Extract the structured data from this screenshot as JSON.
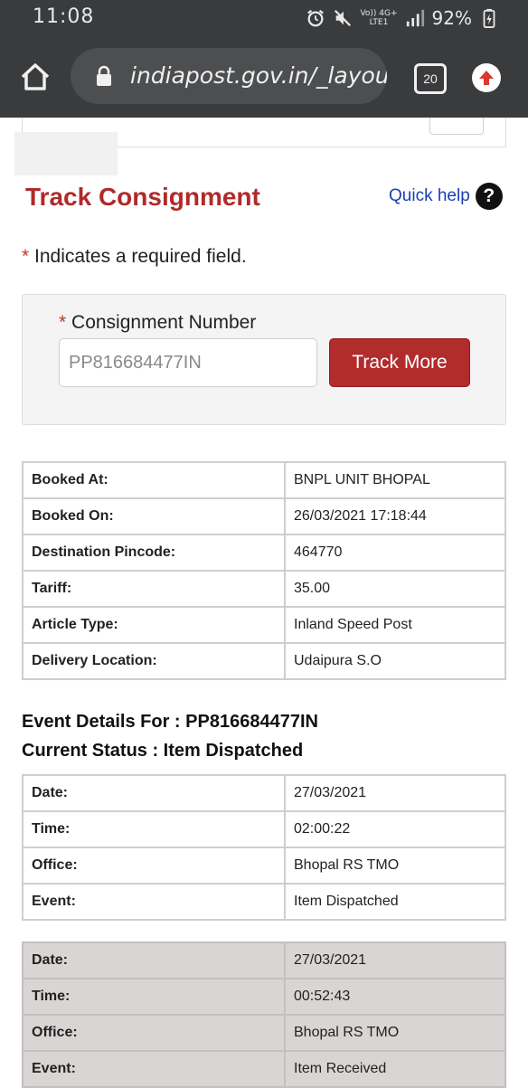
{
  "statusbar": {
    "time": "11:08",
    "network_top": "Vo)) 4G+",
    "network_bottom": "LTE1",
    "battery": "92%",
    "icons": [
      "alarm-icon",
      "mute-icon",
      "signal-icon",
      "battery-icon"
    ]
  },
  "browser": {
    "url": "indiapost.gov.in/_layouts",
    "tab_count": "20",
    "icons": [
      "home-icon",
      "lock-icon",
      "tabs-icon",
      "update-icon"
    ]
  },
  "page": {
    "title": "Track Consignment",
    "quick_help": "Quick help",
    "quick_help_icon": "?",
    "required_star": "*",
    "required_note": " Indicates a required field.",
    "form": {
      "label": "Consignment Number",
      "input_value": "PP816684477IN",
      "button_label": "Track More"
    },
    "booking": [
      {
        "key": "Booked At:",
        "value": "BNPL UNIT BHOPAL"
      },
      {
        "key": "Booked On:",
        "value": "26/03/2021 17:18:44"
      },
      {
        "key": "Destination Pincode:",
        "value": "464770"
      },
      {
        "key": "Tariff:",
        "value": "35.00"
      },
      {
        "key": "Article Type:",
        "value": "Inland Speed Post"
      },
      {
        "key": "Delivery Location:",
        "value": "Udaipura S.O"
      }
    ],
    "event_details_heading": "Event Details For : PP816684477IN",
    "current_status_heading": "Current Status : Item Dispatched",
    "events": [
      [
        {
          "key": "Date:",
          "value": "27/03/2021"
        },
        {
          "key": "Time:",
          "value": "02:00:22"
        },
        {
          "key": "Office:",
          "value": "Bhopal RS TMO"
        },
        {
          "key": "Event:",
          "value": "Item Dispatched"
        }
      ],
      [
        {
          "key": "Date:",
          "value": "27/03/2021"
        },
        {
          "key": "Time:",
          "value": "00:52:43"
        },
        {
          "key": "Office:",
          "value": "Bhopal RS TMO"
        },
        {
          "key": "Event:",
          "value": "Item Received"
        }
      ]
    ]
  },
  "colors": {
    "brand_red": "#b02a2a",
    "link_blue": "#1a3fb5",
    "chrome_dark": "#3a3b3d",
    "shaded_row": "#d9d5d4"
  }
}
